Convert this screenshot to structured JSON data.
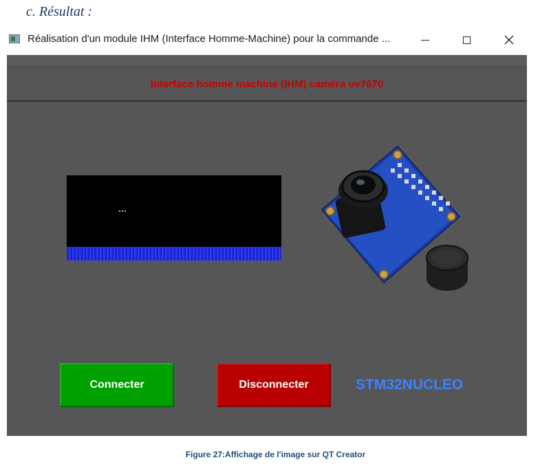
{
  "section_heading": "c.  Résultat :",
  "window": {
    "title": "Réalisation d'un module IHM (Interface Homme-Machine) pour la commande ...",
    "header": "Interface homme machine (IHM)  caméra ov7670",
    "buttons": {
      "connect": "Connecter",
      "disconnect": "Disconnecter"
    },
    "board_label": "STM32NUCLEO"
  },
  "caption": "Figure 27:Affichage de l'image sur QT Creator",
  "colors": {
    "header_text": "#c80000",
    "connect_button": "#00a000",
    "disconnect_button": "#b80000",
    "board_label": "#3c82ff",
    "window_background": "#565656"
  },
  "icons": [
    "app-icon",
    "minimize-icon",
    "maximize-icon",
    "close-icon"
  ]
}
